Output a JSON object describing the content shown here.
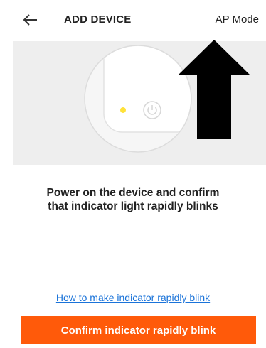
{
  "header": {
    "back_icon": "arrow-left-icon",
    "title": "ADD DEVICE",
    "ap_mode_label": "AP Mode"
  },
  "illustration": {
    "device_icon": "device-with-indicator-light",
    "power_icon": "power-icon",
    "indicator_color": "#ffe23a",
    "pointer_icon": "arrow-up-icon"
  },
  "main": {
    "instruction_line1": "Power on the device and confirm",
    "instruction_line2": "that indicator light rapidly blinks",
    "help_link": "How to make indicator rapidly blink"
  },
  "footer": {
    "confirm_label": "Confirm indicator rapidly blink",
    "confirm_color": "#ff5a0a"
  }
}
